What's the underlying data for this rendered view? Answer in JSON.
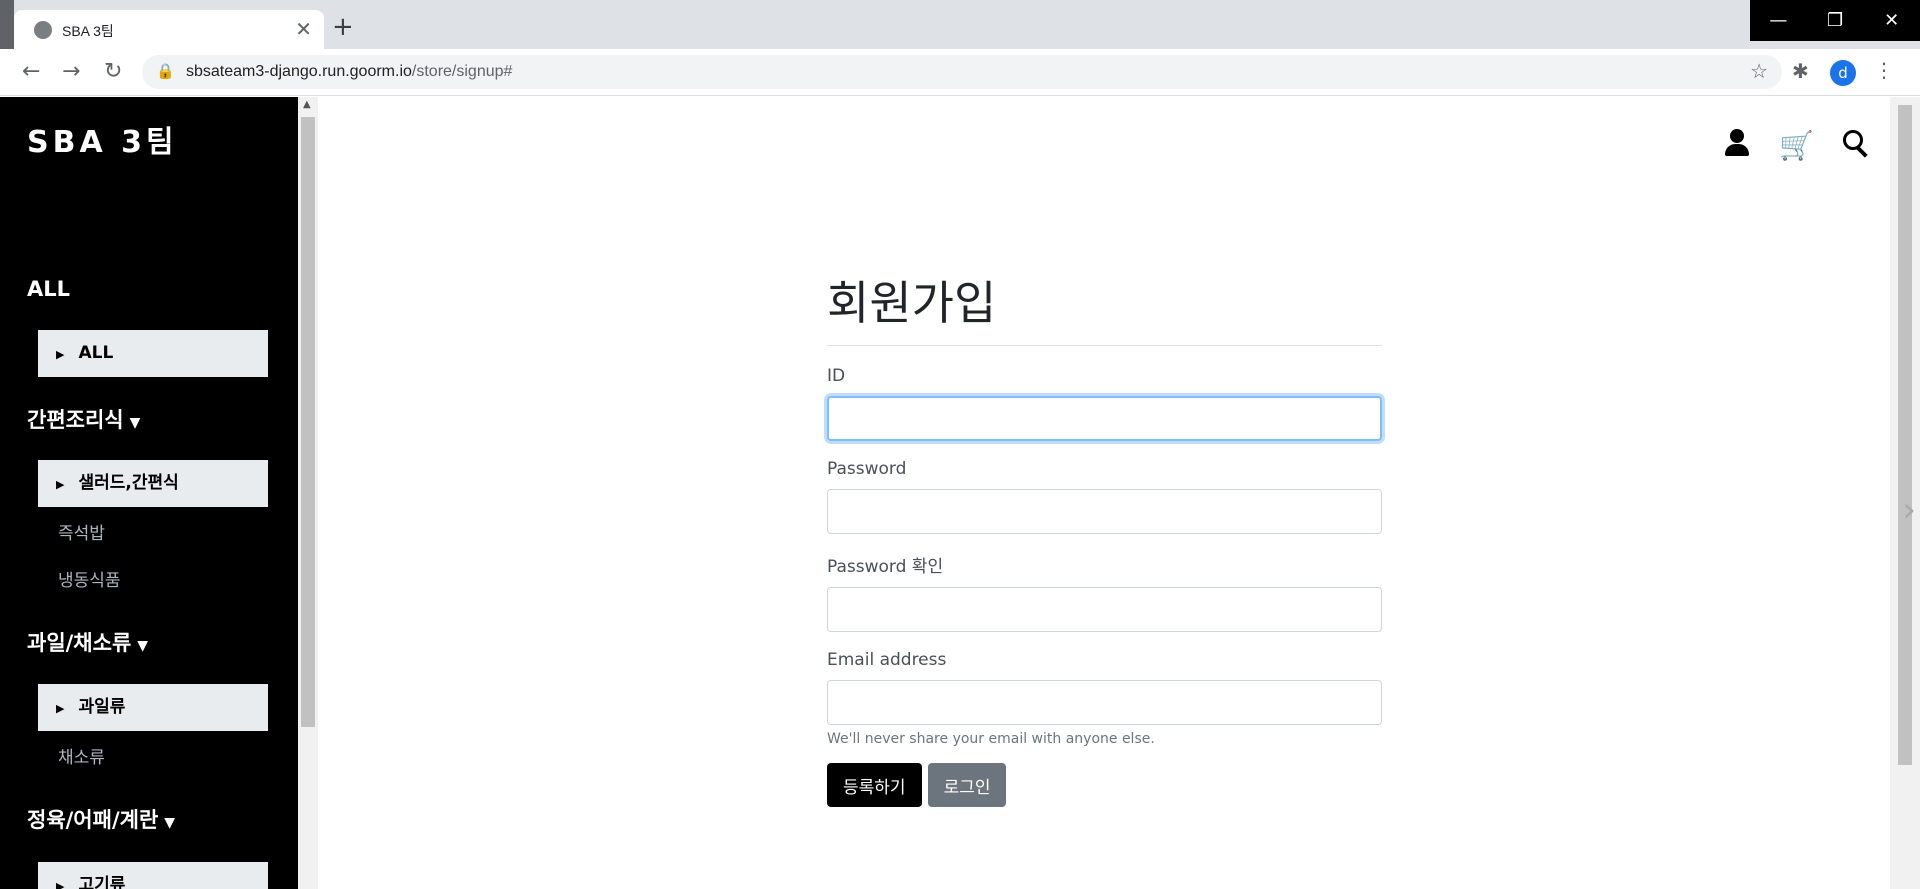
{
  "browser": {
    "tab_title": "SBA 3팀",
    "url_host": "sbsateam3-django.run.goorm.io",
    "url_path": "/store/signup#",
    "avatar_letter": "d"
  },
  "sidebar": {
    "brand": "SBA 3팀",
    "categories": [
      {
        "title": "ALL",
        "items": [
          {
            "label": "ALL",
            "active": true
          }
        ]
      },
      {
        "title": "간편조리식",
        "items": [
          {
            "label": "샐러드,간편식",
            "active": true
          },
          {
            "label": "즉석밥"
          },
          {
            "label": "냉동식품"
          }
        ]
      },
      {
        "title": "과일/채소류",
        "items": [
          {
            "label": "과일류",
            "active": true
          },
          {
            "label": "채소류"
          }
        ]
      },
      {
        "title": "정육/어패/계란",
        "items": [
          {
            "label": "고기류",
            "active": true
          }
        ]
      }
    ]
  },
  "header_icons": [
    "user-icon",
    "cart-icon",
    "search-icon"
  ],
  "form": {
    "title": "회원가입",
    "id_label": "ID",
    "password_label": "Password",
    "password_confirm_label": "Password 확인",
    "email_label": "Email address",
    "email_help": "We'll never share your email with anyone else.",
    "submit_label": "등록하기",
    "login_label": "로그인"
  }
}
